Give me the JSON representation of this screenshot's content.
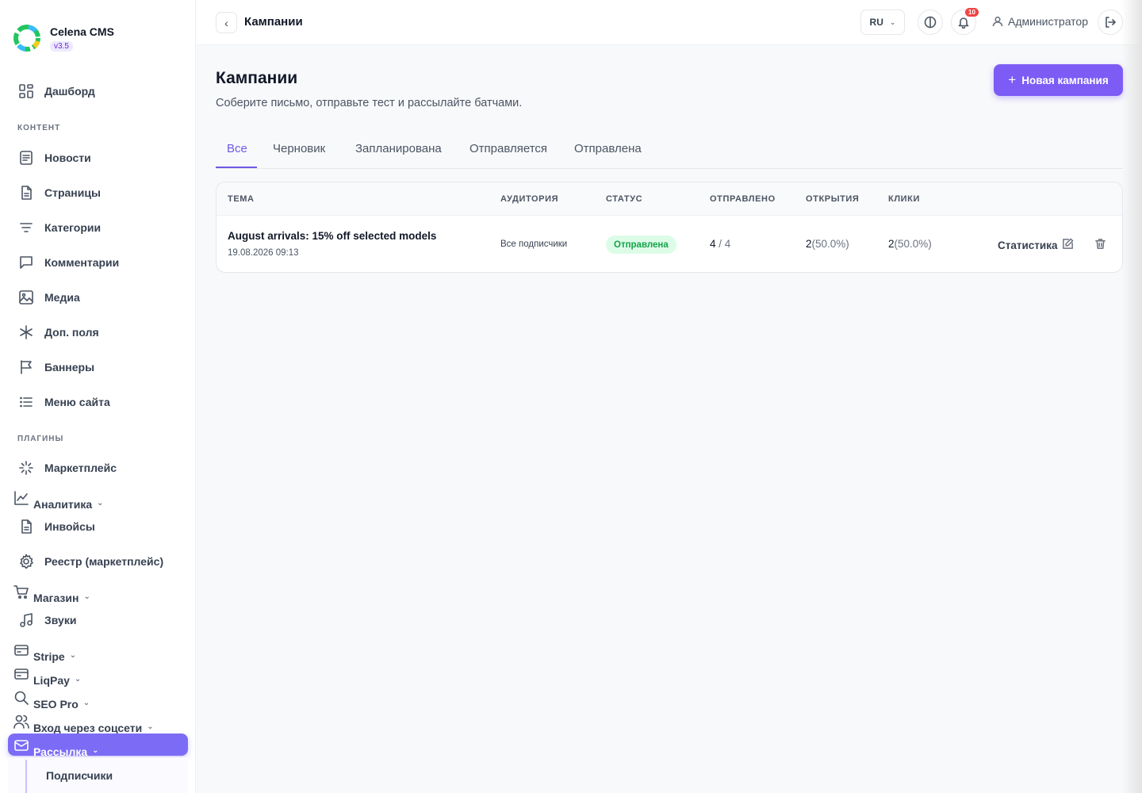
{
  "brand": {
    "name": "Celena CMS",
    "version": "v3.5"
  },
  "sidebar": {
    "dashboard": "Дашборд",
    "section_content": "КОНТЕНТ",
    "news": "Новости",
    "pages": "Страницы",
    "categories": "Категории",
    "comments": "Комментарии",
    "media": "Медиа",
    "extra_fields": "Доп. поля",
    "banners": "Баннеры",
    "site_menu": "Меню сайта",
    "section_plugins": "ПЛАГИНЫ",
    "marketplace": "Маркетплейс",
    "analytics": "Аналитика",
    "invoices": "Инвойсы",
    "registry": "Реестр (маркетплейс)",
    "shop": "Магазин",
    "sounds": "Звуки",
    "stripe": "Stripe",
    "liqpay": "LiqPay",
    "seo_pro": "SEO Pro",
    "social_login": "Вход через соцсети",
    "mailing": "Рассылка",
    "subscribers": "Подписчики"
  },
  "topbar": {
    "title": "Кампании",
    "lang": "RU",
    "notifications_count": "10",
    "user": "Администратор"
  },
  "page": {
    "title": "Кампании",
    "subtitle": "Соберите письмо, отправьте тест и рассылайте батчами.",
    "new_button": "Новая кампания"
  },
  "tabs": [
    "Все",
    "Черновик",
    "Запланирована",
    "Отправляется",
    "Отправлена"
  ],
  "table": {
    "headers": [
      "ТЕМА",
      "АУДИТОРИЯ",
      "СТАТУС",
      "ОТПРАВЛЕНО",
      "ОТКРЫТИЯ",
      "КЛИКИ"
    ],
    "rows": [
      {
        "subject": "August arrivals: 15% off selected models",
        "date": "19.08.2026 09:13",
        "audience": "Все подписчики",
        "status": "Отправлена",
        "sent": "4",
        "sent_total": "/ 4",
        "opens": "2",
        "opens_pct": "(50.0%)",
        "clicks": "2",
        "clicks_pct": "(50.0%)",
        "stats_link": "Статистика"
      }
    ]
  },
  "colors": {
    "accent": "#7c5cf5",
    "status_sent_bg": "#dcfce7",
    "status_sent_text": "#16a34a",
    "badge": "#ef4444"
  }
}
